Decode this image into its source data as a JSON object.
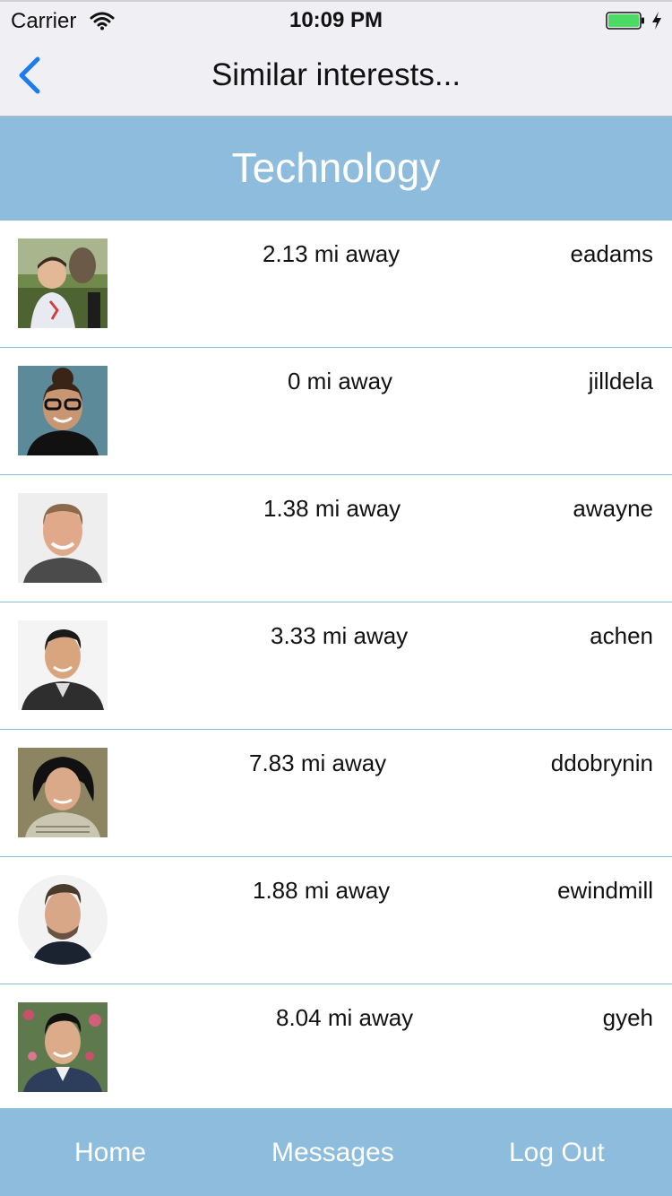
{
  "status_bar": {
    "carrier": "Carrier",
    "time": "10:09 PM",
    "battery_color": "#4cd964"
  },
  "nav_bar": {
    "title": "Similar interests...",
    "back_icon": "chevron-left-icon",
    "accent_color": "#1a7cf0"
  },
  "section": {
    "title": "Technology",
    "background": "#8ebcdc"
  },
  "users": [
    {
      "distance": "2.13 mi away",
      "username": "eadams"
    },
    {
      "distance": "0 mi away",
      "username": "jilldela"
    },
    {
      "distance": "1.38 mi away",
      "username": "awayne"
    },
    {
      "distance": "3.33 mi away",
      "username": "achen"
    },
    {
      "distance": "7.83 mi away",
      "username": "ddobrynin"
    },
    {
      "distance": "1.88 mi away",
      "username": "ewindmill"
    },
    {
      "distance": "8.04 mi away",
      "username": "gyeh"
    }
  ],
  "tab_bar": {
    "home": "Home",
    "messages": "Messages",
    "logout": "Log Out"
  }
}
